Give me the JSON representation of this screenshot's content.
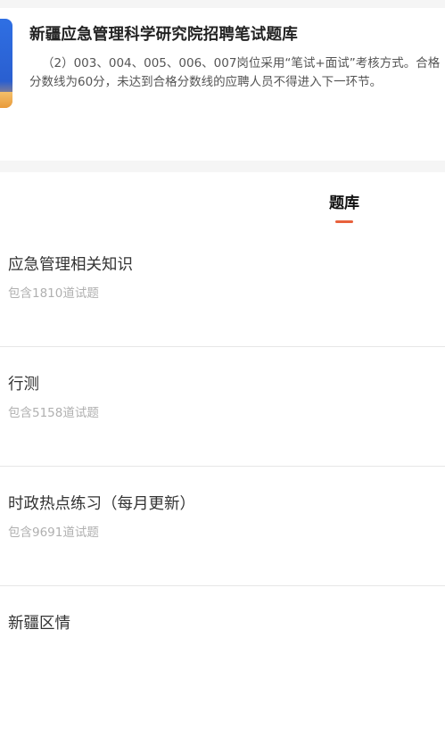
{
  "header": {
    "title": "新疆应急管理科学研究院招聘笔试题库",
    "description": "（2）003、004、005、006、007岗位采用“笔试+面试”考核方式。合格分数线为60分，未达到合格分数线的应聘人员不得进入下一环节。"
  },
  "tabs": [
    {
      "label": "题库",
      "active": true
    }
  ],
  "question_banks": [
    {
      "name": "应急管理相关知识",
      "count": "包含1810道试题"
    },
    {
      "name": "行测",
      "count": "包含5158道试题"
    },
    {
      "name": "时政热点练习（每月更新）",
      "count": "包含9691道试题"
    },
    {
      "name": "新疆区情",
      "count": ""
    }
  ],
  "colors": {
    "accent": "#e8613c",
    "title_text": "#222222",
    "secondary_text": "#b0b0b0",
    "divider": "#e6e6e6",
    "background_gap": "#f5f5f5"
  }
}
